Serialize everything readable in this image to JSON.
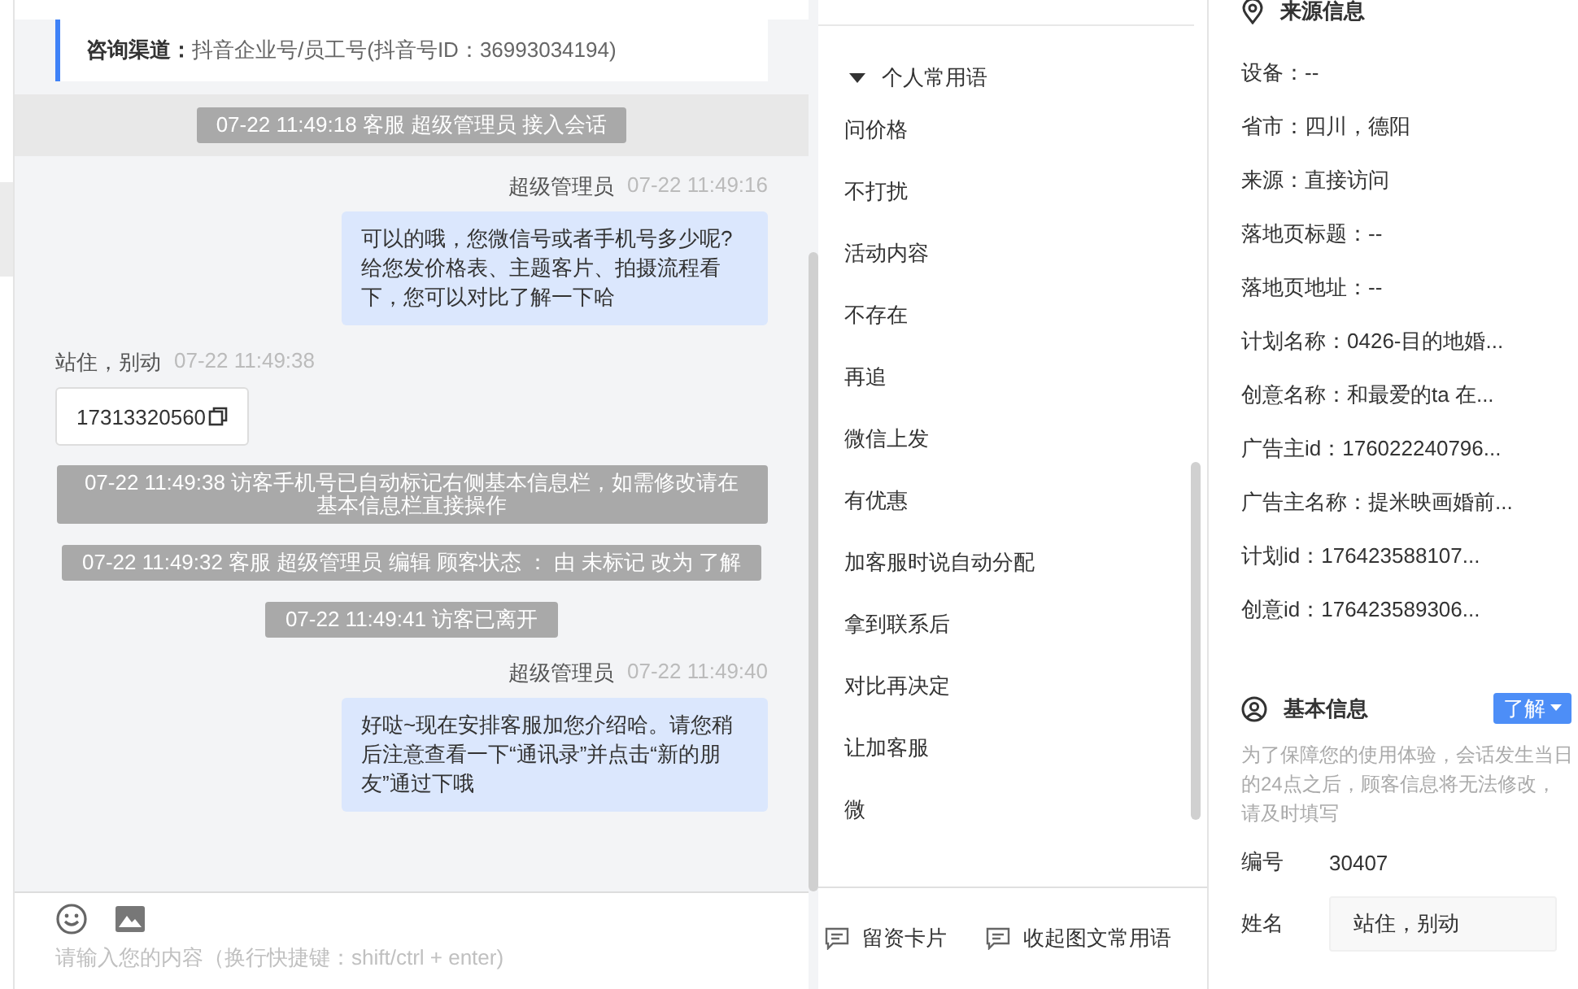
{
  "channel": {
    "label": "咨询渠道：",
    "value": "抖音企业号/员工号(抖音号ID：36993034194)"
  },
  "messages": [
    {
      "kind": "system",
      "banded": true,
      "text": "07-22 11:49:18 客服 超级管理员 接入会话"
    },
    {
      "kind": "outgoing",
      "sender": "超级管理员",
      "time": "07-22 11:49:16",
      "text": "可以的哦，您微信号或者手机号多少呢?给您发价格表、主题客片、拍摄流程看下，您可以对比了解一下哈"
    },
    {
      "kind": "card",
      "sender": "站住，别动",
      "time": "07-22 11:49:38",
      "text": "17313320560"
    },
    {
      "kind": "system",
      "banded": false,
      "text": "07-22 11:49:38 访客手机号已自动标记右侧基本信息栏，如需修改请在基本信息栏直接操作"
    },
    {
      "kind": "system",
      "banded": false,
      "text": "07-22 11:49:32 客服 超级管理员 编辑 顾客状态 ： 由 未标记 改为 了解"
    },
    {
      "kind": "system",
      "banded": false,
      "text": "07-22 11:49:41 访客已离开"
    },
    {
      "kind": "outgoing",
      "sender": "超级管理员",
      "time": "07-22 11:49:40",
      "text": "好哒~现在安排客服加您介绍哈。请您稍后注意查看一下“通讯录”并点击“新的朋友”通过下哦"
    }
  ],
  "composer": {
    "placeholder": "请输入您的内容（换行快捷键：shift/ctrl + enter)"
  },
  "phrases": {
    "group": "个人常用语",
    "expanded": true,
    "items": [
      "问价格",
      "不打扰",
      "活动内容",
      "不存在",
      "再追",
      "微信上发",
      "有优惠",
      "加客服时说自动分配",
      "拿到联系后",
      "对比再决定",
      "让加客服",
      "微"
    ]
  },
  "actions": [
    "留资卡片",
    "收起图文常用语"
  ],
  "source": {
    "title": "来源信息",
    "rows": [
      "设备：--",
      "省市：四川，德阳",
      "来源：直接访问",
      "落地页标题：--",
      "落地页地址：--",
      "计划名称：0426-目的地婚...",
      "创意名称：和最爱的ta 在...",
      "广告主id：176022240796...",
      "广告主名称：提米映画婚前...",
      "计划id：176423588107...",
      "创意id：176423589306..."
    ]
  },
  "basic": {
    "title": "基本信息",
    "status": "了解",
    "note": "为了保障您的使用体验，会话发生当日的24点之后，顾客信息将无法修改，请及时填写",
    "fields": [
      {
        "kind": "text",
        "label": "编号",
        "value": "30407"
      },
      {
        "kind": "input",
        "label": "姓名",
        "value": "站住，别动"
      }
    ]
  }
}
